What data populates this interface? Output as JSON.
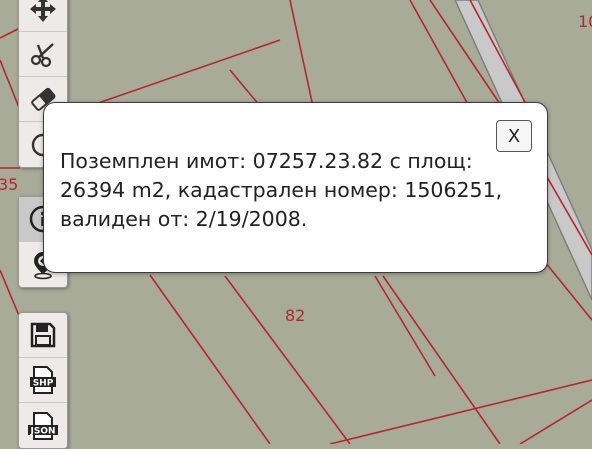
{
  "map": {
    "parcel_labels": [
      "10",
      "35",
      "82"
    ],
    "colors": {
      "background": "#a8ab98",
      "parcel_line": "#b5262a",
      "road_fill": "#c9c9c9",
      "road_edge": "#7e7e7e"
    }
  },
  "toolbar_top": [
    {
      "name": "pan-tool",
      "icon": "move-arrows-icon"
    },
    {
      "name": "cut-tool",
      "icon": "scissors-icon"
    },
    {
      "name": "erase-tool",
      "icon": "eraser-icon"
    },
    {
      "name": "undo-tool",
      "icon": "undo-icon"
    },
    {
      "name": "info-tool",
      "icon": "info-icon",
      "active": true
    },
    {
      "name": "locate-tool",
      "icon": "map-pin-icon"
    }
  ],
  "toolbar_bottom": [
    {
      "name": "save-tool",
      "icon": "floppy-disk-icon"
    },
    {
      "name": "export-shp-tool",
      "icon": "shp-file-icon",
      "badge": "SHP"
    },
    {
      "name": "export-json-tool",
      "icon": "json-file-icon",
      "badge": "JSON"
    }
  ],
  "popup": {
    "close_label": "X",
    "text": "Поземплен имот: 07257.23.82 с площ: 26394 m2, кадастрален номер: 1506251, валиден от: 2/19/2008."
  }
}
